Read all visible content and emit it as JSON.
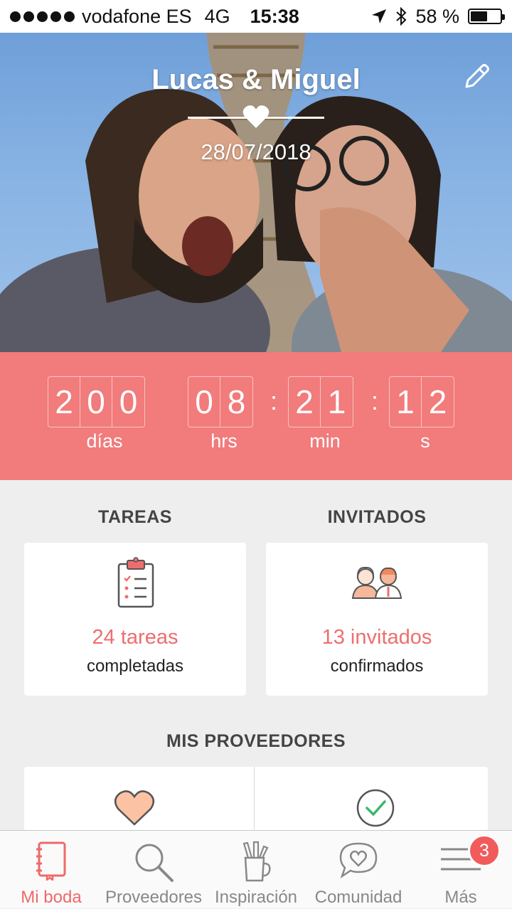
{
  "status_bar": {
    "carrier": "vodafone ES",
    "network": "4G",
    "time": "15:38",
    "battery": "58 %",
    "battery_level": 0.58
  },
  "header": {
    "title": "Lucas & Miguel",
    "date": "28/07/2018"
  },
  "countdown": {
    "days_digits": [
      "2",
      "0",
      "0"
    ],
    "hours_digits": [
      "0",
      "8"
    ],
    "minutes_digits": [
      "2",
      "1"
    ],
    "seconds_digits": [
      "1",
      "2"
    ],
    "separator": ":",
    "labels": {
      "days": "días",
      "hours": "hrs",
      "minutes": "min",
      "seconds": "s"
    }
  },
  "tasks": {
    "section_title": "TAREAS",
    "count": "24 tareas",
    "caption": "completadas"
  },
  "guests": {
    "section_title": "INVITADOS",
    "count": "13 invitados",
    "caption": "confirmados"
  },
  "providers": {
    "section_title": "MIS PROVEEDORES"
  },
  "tab_bar": {
    "items": [
      {
        "label": "Mi boda",
        "icon": "notebook-icon",
        "active": true
      },
      {
        "label": "Proveedores",
        "icon": "search-icon",
        "active": false
      },
      {
        "label": "Inspiración",
        "icon": "pencil-cup-icon",
        "active": false
      },
      {
        "label": "Comunidad",
        "icon": "heart-chat-icon",
        "active": false
      },
      {
        "label": "Más",
        "icon": "menu-icon",
        "active": false
      }
    ],
    "more_badge": "3"
  },
  "colors": {
    "accent": "#f27b7b",
    "active_tab": "#f06868",
    "card_text_accent": "#ee6e6e"
  }
}
